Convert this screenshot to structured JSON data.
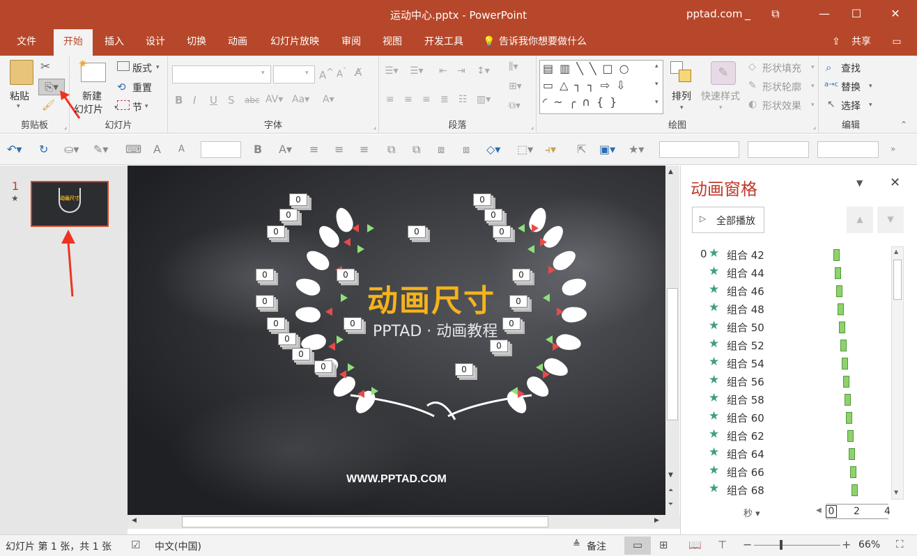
{
  "window": {
    "title": "运动中心.pptx - PowerPoint",
    "account": "pptad.com",
    "controls": {
      "minimize": "_",
      "ribbon_options": "⧉",
      "min2": "—",
      "max": "☐",
      "close": "✕"
    }
  },
  "tabs": [
    "文件",
    "开始",
    "插入",
    "设计",
    "切换",
    "动画",
    "幻灯片放映",
    "审阅",
    "视图",
    "开发工具"
  ],
  "tellme": "告诉我你想要做什么",
  "share": "共享",
  "ribbon": {
    "clipboard": {
      "label": "剪贴板",
      "paste": "粘贴"
    },
    "slides": {
      "label": "幻灯片",
      "new_line1": "新建",
      "new_line2": "幻灯片",
      "layout": "版式",
      "reset": "重置",
      "section": "节"
    },
    "font": {
      "label": "字体"
    },
    "paragraph": {
      "label": "段落"
    },
    "drawing": {
      "label": "绘图",
      "arrange": "排列",
      "quickstyles": "快速样式",
      "fill": "形状填充",
      "outline": "形状轮廓",
      "effects": "形状效果"
    },
    "editing": {
      "label": "编辑",
      "find": "查找",
      "replace": "替换",
      "select": "选择"
    }
  },
  "thumbnail": {
    "number": "1",
    "star": "★",
    "title": "动画尺寸"
  },
  "slide": {
    "title": "动画尺寸",
    "subtitle": "PPTAD · 动画教程",
    "url": "WWW.PPTAD.COM",
    "tag": "0"
  },
  "pane": {
    "title": "动画窗格",
    "play_all": "全部播放",
    "first_index": "0",
    "items": [
      "组合 42",
      "组合 44",
      "组合 46",
      "组合 48",
      "组合 50",
      "组合 52",
      "组合 54",
      "组合 56",
      "组合 58",
      "组合 60",
      "组合 62",
      "组合 64",
      "组合 66",
      "组合 68"
    ],
    "seconds": "秒",
    "timeline": [
      "0",
      "2",
      "4"
    ]
  },
  "status": {
    "slide_info": "幻灯片 第 1 张，共 1 张",
    "language": "中文(中国)",
    "notes": "备注",
    "zoom": "66%"
  }
}
